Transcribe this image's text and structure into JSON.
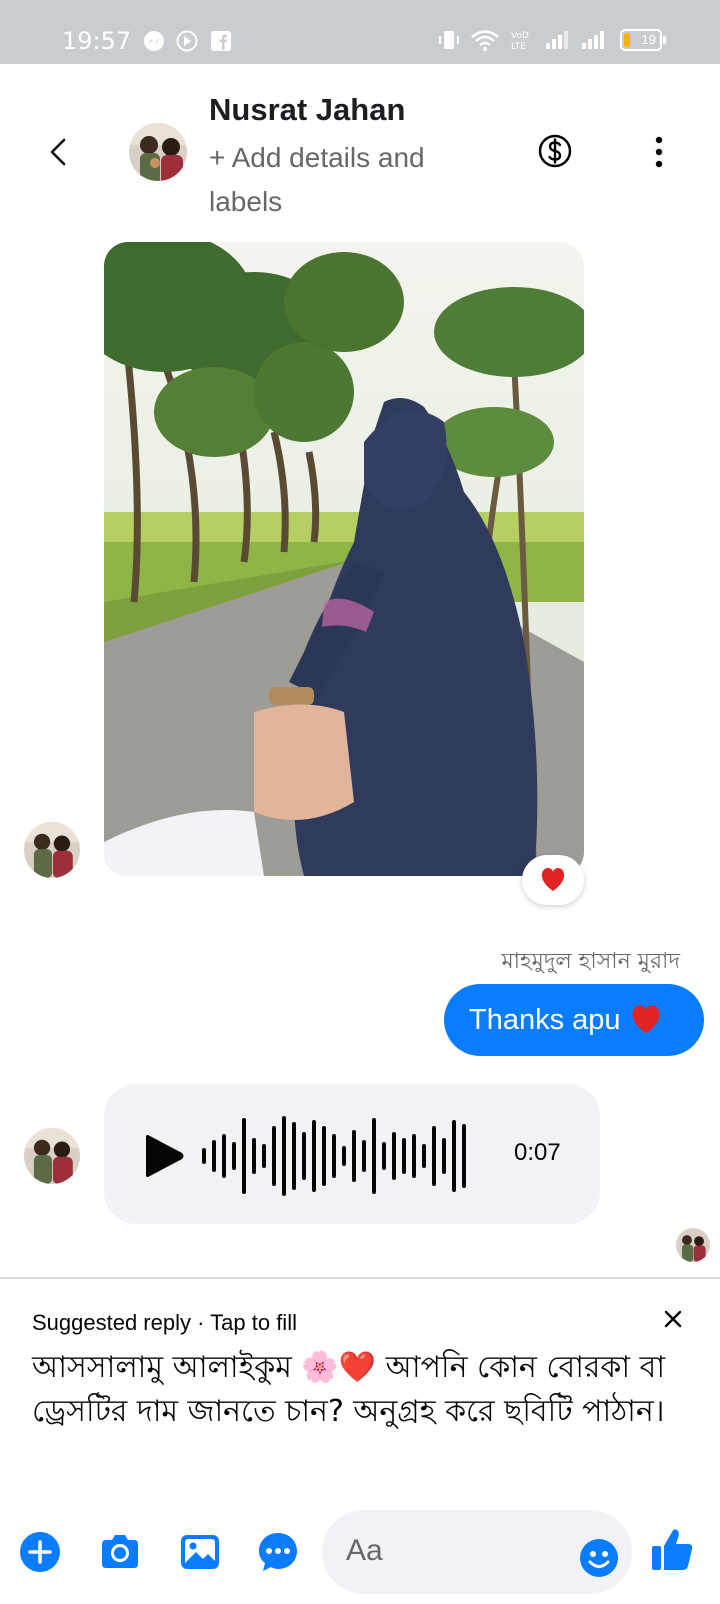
{
  "status_bar": {
    "time": "19:57",
    "battery": "19"
  },
  "header": {
    "contact_name": "Nusrat Jahan",
    "subtitle": "+ Add details and labels"
  },
  "messages": {
    "photo_reaction": "heart",
    "outgoing_sender": "মাহমুদুল হাসান মুরাদ",
    "outgoing_text": "Thanks apu",
    "voice_duration": "0:07"
  },
  "suggested_reply": {
    "label": "Suggested reply · Tap to fill",
    "text": "আসসালামু আলাইকুম 🌸❤️ আপনি কোন বোরকা বা ড্রেসটির দাম জানতে চান? অনুগ্রহ করে ছবিটি পাঠান।"
  },
  "composer": {
    "placeholder": "Aa"
  },
  "colors": {
    "accent": "#0a7cff",
    "heart": "#e02424",
    "statusbar": "#c9cdd2"
  }
}
